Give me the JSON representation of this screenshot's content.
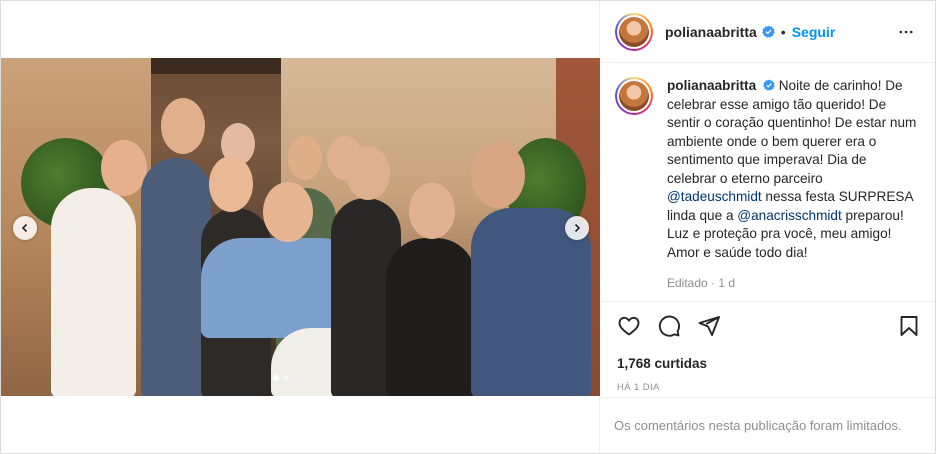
{
  "post": {
    "username": "polianaabritta",
    "follow_label": "Seguir",
    "separator": "•",
    "caption": {
      "part1": " Noite de carinho! De celebrar esse amigo tão querido! De sentir o coração quentinho! De estar num ambiente onde o bem querer era o sentimento que imperava! Dia de celebrar o eterno parceiro ",
      "mention1": "@tadeuschmidt",
      "part2": " nessa festa SURPRESA linda que a ",
      "mention2": "@anacrisschmidt",
      "part3": " preparou! Luz e proteção pra você, meu amigo! Amor e saúde todo dia!"
    },
    "edited": "Editado · 1 d",
    "likes": "1,768 curtidas",
    "time_ago": "HÁ 1 DIA",
    "comments_limited": "Os comentários nesta publicação foram limitados.",
    "carousel": {
      "total_slides": 2,
      "current_slide": 1
    }
  },
  "icons": {
    "verified": "verified-badge-icon",
    "more": "more-options-icon",
    "like": "heart-icon",
    "comment": "comment-icon",
    "share": "share-icon",
    "save": "bookmark-icon",
    "prev": "chevron-left-icon",
    "next": "chevron-right-icon"
  },
  "colors": {
    "link": "#0095f6",
    "mention": "#00376b",
    "muted": "#8e8e8e",
    "text": "#262626"
  }
}
